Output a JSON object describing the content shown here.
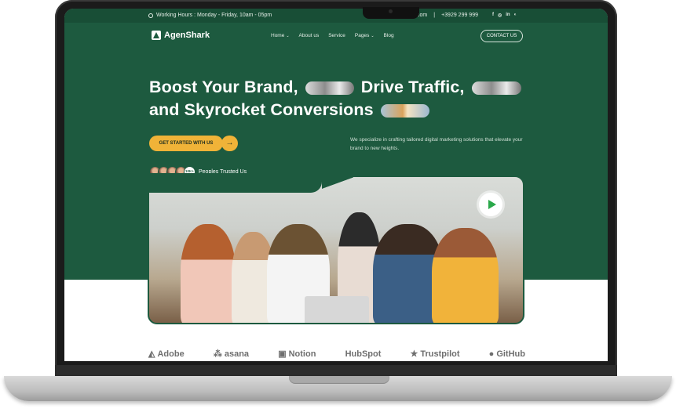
{
  "topbar": {
    "hours": "Working Hours : Monday - Friday, 10am - 05pm",
    "email": "agenshark@test.com",
    "phone": "+3929 299 999",
    "social": [
      "f",
      "◎",
      "in",
      "◐"
    ]
  },
  "nav": {
    "logo": "AgenShark",
    "items": [
      {
        "label": "Home",
        "caret": true
      },
      {
        "label": "About us",
        "caret": false
      },
      {
        "label": "Service",
        "caret": false
      },
      {
        "label": "Pages",
        "caret": true
      },
      {
        "label": "Blog",
        "caret": false
      }
    ],
    "cta": "CONTACT US"
  },
  "hero": {
    "line1_a": "Boost Your Brand,",
    "line1_b": "Drive Traffic,",
    "line2": "and Skyrocket Conversions",
    "cta": "GET STARTED WITH US",
    "cta_arrow": "→",
    "tagline": "We specialize in crafting tailored digital marketing solutions that elevate your brand to new heights.",
    "trusted_label": "Peoples Trusted Us",
    "trusted_count": "10K+"
  },
  "brands": [
    {
      "name": "Adobe",
      "icon": "adobe-icon"
    },
    {
      "name": "asana",
      "icon": "asana-icon"
    },
    {
      "name": "Notion",
      "icon": "notion-icon"
    },
    {
      "name": "HubSpot",
      "icon": ""
    },
    {
      "name": "Trustpilot",
      "icon": "star-icon"
    },
    {
      "name": "GitHub",
      "icon": "github-icon"
    }
  ],
  "colors": {
    "primary": "#1d5a3f",
    "accent": "#f0b338",
    "play": "#2aa84a"
  }
}
